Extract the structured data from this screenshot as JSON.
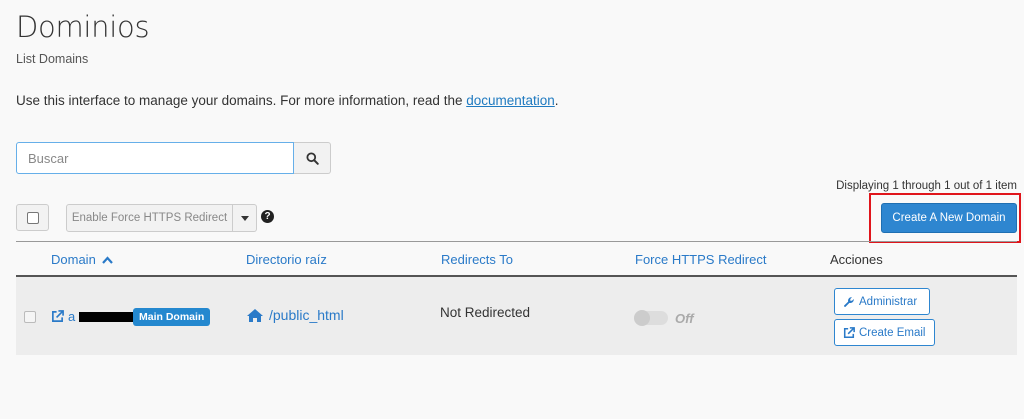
{
  "page": {
    "title": "Dominios",
    "subtitle": "List Domains",
    "description_prefix": "Use this interface to manage your domains. For more information, read the ",
    "description_link": "documentation",
    "description_suffix": "."
  },
  "search": {
    "placeholder": "Buscar",
    "icon": "search-icon"
  },
  "pagination": {
    "text": "Displaying 1 through 1 out of 1 item"
  },
  "toolbar": {
    "force_https_label": "Enable Force HTTPS Redirect",
    "help_icon": "question-circle-icon",
    "create_label": "Create A New Domain",
    "highlight_color": "#e0151b",
    "accent_color": "#2e86d0"
  },
  "table": {
    "columns": [
      "Domain",
      "Directorio raíz",
      "Redirects To",
      "Force HTTPS Redirect",
      "Acciones"
    ],
    "sort_icon": "chevron-up-icon",
    "rows": [
      {
        "domain_prefix": "a",
        "badge": "Main Domain",
        "root_dir": "/public_html",
        "redirects_to": "Not Redirected",
        "force_https": "Off",
        "actions": [
          "Administrar",
          "Create Email"
        ]
      }
    ]
  }
}
